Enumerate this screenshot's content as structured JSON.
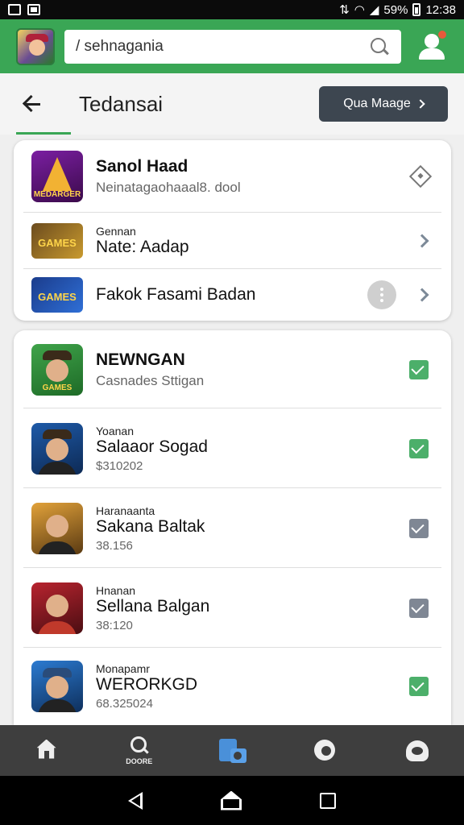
{
  "status_bar": {
    "battery": "59%",
    "time": "12:38"
  },
  "search": {
    "query": "/ sehnagania"
  },
  "title_bar": {
    "title": "Tedansai",
    "action_label": "Qua Maage"
  },
  "top_card": [
    {
      "title": "Sanol Haad",
      "subtitle": "Neinatagaohaaal8. dool",
      "thumb_text": "MEDARGER"
    },
    {
      "label": "Gennan",
      "title": "Nate: Aadap",
      "thumb_text": "GAMES"
    },
    {
      "title": "Fakok Fasami Badan",
      "thumb_text": "GAMES"
    }
  ],
  "list": [
    {
      "title": "NEWNGAN",
      "subtitle": "Casnades Sttigan",
      "checked_color": "green"
    },
    {
      "label": "Yoanan",
      "title": "Salaaor Sogad",
      "number": "$310202",
      "checked_color": "green"
    },
    {
      "label": "Haranaanta",
      "title": "Sakana Baltak",
      "number": "38.156",
      "checked_color": "gray"
    },
    {
      "label": "Hnanan",
      "title": "Sellana Balgan",
      "number": "38:120",
      "checked_color": "gray"
    },
    {
      "label": "Monapamr",
      "title": "WERORKGD",
      "number": "68.325024",
      "checked_color": "green"
    }
  ],
  "bottom_nav": {
    "search_label": "DOORE"
  },
  "colors": {
    "header_green": "#3aa655",
    "check_green": "#4caf6a",
    "check_gray": "#7f8794",
    "nav_active_blue": "#4a90d9"
  }
}
